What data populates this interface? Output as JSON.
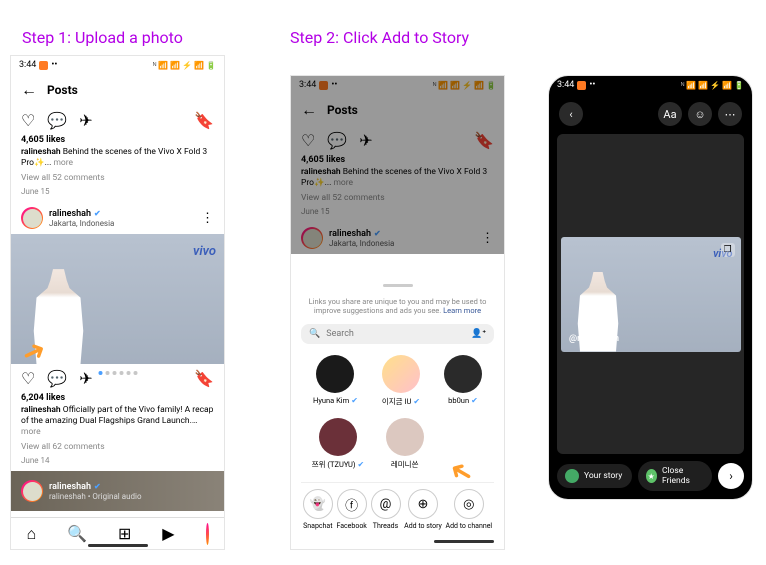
{
  "steps": {
    "step1": "Step 1: Upload a  photo",
    "step2": "Step 2: Click Add to Story"
  },
  "status": {
    "time": "3:44",
    "icons": "✕ 📶 📶 🔇 📶 🔋"
  },
  "header": {
    "title": "Posts"
  },
  "post1": {
    "likes": "4,605 likes",
    "username": "ralineshah",
    "caption": " Behind the scenes of the Vivo X Fold 3 Pro✨... ",
    "more": "more",
    "comments": "View all 52 comments",
    "date": "June 15"
  },
  "profile": {
    "name": "ralineshah",
    "location": "Jakarta, Indonesia",
    "audio": "Original audio"
  },
  "post2": {
    "likes": "6,204 likes",
    "username": "ralineshah",
    "caption": " Officially part of the Vivo family! A recap of the amazing Dual Flagships Grand Launch.… ",
    "more": "more",
    "comments": "View all 62 comments",
    "date": "June 14"
  },
  "sheet": {
    "privacy": "Links you share are unique to you and may be used to improve suggestions and ads you see. ",
    "learn_more": "Learn more",
    "search_placeholder": "Search"
  },
  "friends": [
    {
      "name": "Hyuna Kim"
    },
    {
      "name": "이지금 IU"
    },
    {
      "name": "bb0un"
    },
    {
      "name": "쯔위 (TZUYU)"
    },
    {
      "name": "레미니쓴"
    }
  ],
  "share": [
    {
      "label": "Snapchat"
    },
    {
      "label": "Facebook"
    },
    {
      "label": "Threads"
    },
    {
      "label": "Add to story"
    },
    {
      "label": "Add to channel"
    }
  ],
  "story": {
    "tag": "@ralineshah",
    "your_story": "Your story",
    "close_friends": "Close Friends",
    "aa": "Aa"
  },
  "vivo": "vivo"
}
